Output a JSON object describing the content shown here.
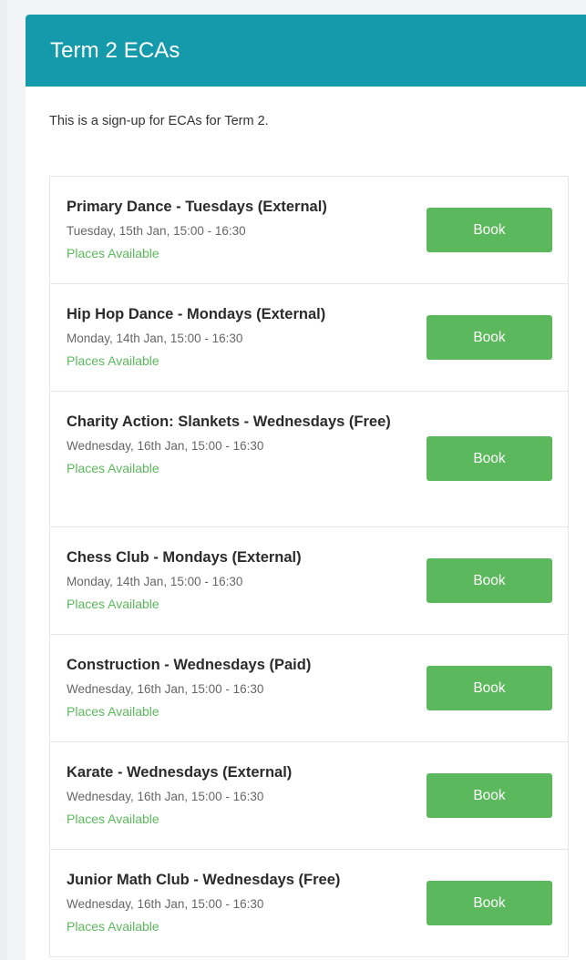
{
  "panel": {
    "title": "Term 2 ECAs",
    "intro": "This is a sign-up for ECAs for Term 2."
  },
  "colors": {
    "header": "#149aaa",
    "accent_green": "#5cb85c"
  },
  "items": [
    {
      "title": "Primary Dance - Tuesdays (External)",
      "date": "Tuesday, 15th Jan, 15:00 - 16:30",
      "status": "Places Available",
      "button": "Book"
    },
    {
      "title": "Hip Hop Dance - Mondays (External)",
      "date": "Monday, 14th Jan, 15:00 - 16:30",
      "status": "Places Available",
      "button": "Book"
    },
    {
      "title": "Charity Action: Slankets - Wednesdays (Free)",
      "date": "Wednesday, 16th Jan, 15:00 - 16:30",
      "status": "Places Available",
      "button": "Book"
    },
    {
      "title": "Chess Club - Mondays (External)",
      "date": "Monday, 14th Jan, 15:00 - 16:30",
      "status": "Places Available",
      "button": "Book"
    },
    {
      "title": "Construction - Wednesdays (Paid)",
      "date": "Wednesday, 16th Jan, 15:00 - 16:30",
      "status": "Places Available",
      "button": "Book"
    },
    {
      "title": "Karate - Wednesdays (External)",
      "date": "Wednesday, 16th Jan, 15:00 - 16:30",
      "status": "Places Available",
      "button": "Book"
    },
    {
      "title": "Junior Math Club - Wednesdays (Free)",
      "date": "Wednesday, 16th Jan, 15:00 - 16:30",
      "status": "Places Available",
      "button": "Book"
    }
  ]
}
